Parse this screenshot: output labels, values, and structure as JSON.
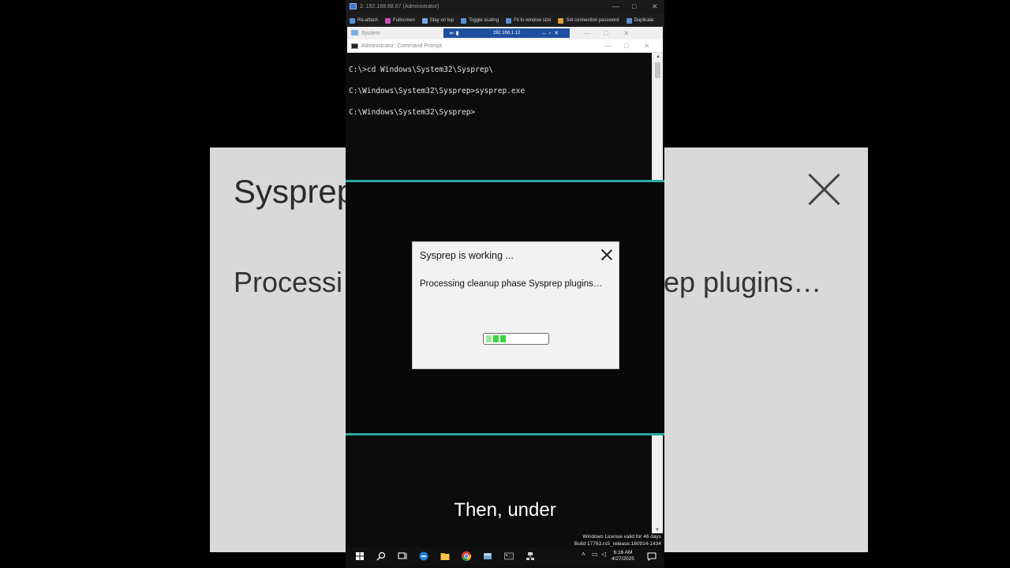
{
  "background_zoom": {
    "title": "Sysprep",
    "body_left": "Processi",
    "body_right": "ep plugins…"
  },
  "rdp": {
    "window_title": "2. 192.168.68.67 (Administrator)",
    "toolbar": [
      "Re-attach",
      "Fullscreen",
      "Stay on top",
      "Toggle scaling",
      "Fit to window size",
      "Set connection password",
      "Duplicate"
    ],
    "controls": [
      "—",
      "□",
      "✕"
    ]
  },
  "system_window": {
    "title": "System",
    "connection_ip": "192.168.1.12",
    "controls": [
      "—",
      "□",
      "✕"
    ]
  },
  "cmd": {
    "title": "Administrator: Command Prompt",
    "lines": [
      "C:\\>cd Windows\\System32\\Sysprep\\",
      "C:\\Windows\\System32\\Sysprep>sysprep.exe",
      "C:\\Windows\\System32\\Sysprep>"
    ],
    "controls": [
      "—",
      "□",
      "✕"
    ]
  },
  "dialog": {
    "title": "Sysprep is working ...",
    "message": "Processing cleanup phase Sysprep plugins…",
    "progress_blocks": 3
  },
  "license": {
    "line1": "Windows License valid for 46 days",
    "line2": "Build 17763.rs5_release.180914-1434"
  },
  "taskbar": {
    "time": "6:16 AM",
    "date": "4/27/2025"
  },
  "subtitle": "Then, under",
  "colors": {
    "separator": "#2aa8a0",
    "progress": "#38d43c",
    "connection_bar": "#1f4fa0"
  }
}
